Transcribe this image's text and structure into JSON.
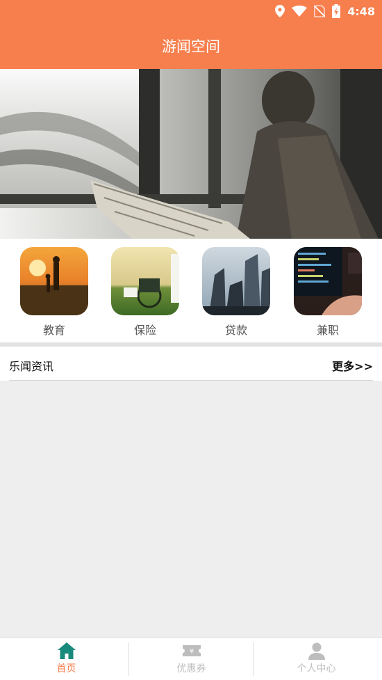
{
  "status_bar": {
    "time": "4:48",
    "icons": [
      "location-icon",
      "wifi-icon",
      "no-sim-icon",
      "battery-charging-icon"
    ]
  },
  "app_bar": {
    "title": "游闻空间"
  },
  "banner": {
    "image": "man-reading-newspaper-statue"
  },
  "categories": [
    {
      "label": "教育",
      "image": "father-child-sunset"
    },
    {
      "label": "保险",
      "image": "wheelchair-elderly"
    },
    {
      "label": "贷款",
      "image": "skyscrapers"
    },
    {
      "label": "兼职",
      "image": "laptop-coding"
    }
  ],
  "news": {
    "title": "乐闻资讯",
    "more": "更多>>"
  },
  "bottom_nav": [
    {
      "label": "首页",
      "icon": "home-icon",
      "active": true
    },
    {
      "label": "优惠券",
      "icon": "coupon-icon",
      "active": false
    },
    {
      "label": "个人中心",
      "icon": "person-icon",
      "active": false
    }
  ],
  "colors": {
    "primary": "#f77f4d",
    "nav_active_icon": "#1a8a7c",
    "nav_active_label": "#f77f4d",
    "nav_inactive": "#bdbdbd"
  }
}
